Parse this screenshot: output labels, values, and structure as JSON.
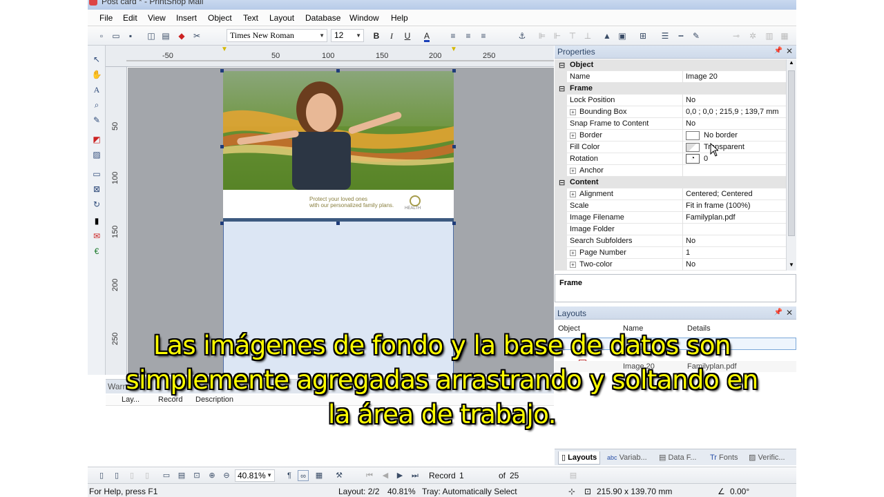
{
  "window": {
    "title": "Post card * - PrintShop Mail"
  },
  "menu": [
    "File",
    "Edit",
    "View",
    "Insert",
    "Object",
    "Text",
    "Layout",
    "Database",
    "Window",
    "Help"
  ],
  "toolbar": {
    "font": "Times New Roman",
    "size": "12",
    "bold": "B",
    "italic": "I",
    "underline": "U",
    "font_color": "A"
  },
  "ruler": {
    "top_labels": [
      "-50",
      "50",
      "100",
      "150",
      "200",
      "250"
    ],
    "left_labels": [
      "50",
      "100",
      "150",
      "200",
      "250"
    ]
  },
  "postcard": {
    "tagline_1": "Protect your loved ones",
    "tagline_2": "with our personalized family plans.",
    "logo_text": "HEALTH"
  },
  "warnings": {
    "title": "Warnin",
    "columns": [
      "Lay...",
      "Record",
      "Description"
    ]
  },
  "properties": {
    "title": "Properties",
    "rows": [
      {
        "type": "cat",
        "label": "Object"
      },
      {
        "type": "prop",
        "label": "Name",
        "value": "Image 20"
      },
      {
        "type": "cat",
        "label": "Frame"
      },
      {
        "type": "prop",
        "label": "Lock Position",
        "value": "No"
      },
      {
        "type": "expand",
        "label": "Bounding Box",
        "value": "0,0 ; 0,0 ; 215,9 ; 139,7 mm"
      },
      {
        "type": "prop",
        "label": "Snap Frame to Content",
        "value": "No"
      },
      {
        "type": "expand",
        "label": "Border",
        "value": "No border",
        "swatch": "border"
      },
      {
        "type": "prop",
        "label": "Fill Color",
        "value": "Transparent",
        "swatch": "fill"
      },
      {
        "type": "prop",
        "label": "Rotation",
        "value": "0",
        "swatch": "rotation"
      },
      {
        "type": "expand",
        "label": "Anchor",
        "value": ""
      },
      {
        "type": "cat",
        "label": "Content"
      },
      {
        "type": "expand",
        "label": "Alignment",
        "value": "Centered; Centered"
      },
      {
        "type": "prop",
        "label": "Scale",
        "value": "Fit in frame (100%)"
      },
      {
        "type": "prop",
        "label": "Image Filename",
        "value": "Familyplan.pdf"
      },
      {
        "type": "prop",
        "label": "Image Folder",
        "value": ""
      },
      {
        "type": "prop",
        "label": "Search Subfolders",
        "value": "No"
      },
      {
        "type": "expand",
        "label": "Page Number",
        "value": "1"
      },
      {
        "type": "expand",
        "label": "Two-color",
        "value": "No"
      }
    ],
    "description_title": "Frame"
  },
  "layouts": {
    "title": "Layouts",
    "columns": [
      "Object",
      "Name",
      "Details"
    ],
    "row_name": "Image 20",
    "row_details": "Familyplan.pdf",
    "tabs": [
      "Layouts",
      "Variab...",
      "Data F...",
      "Fonts",
      "Verific..."
    ]
  },
  "bottom": {
    "zoom": "40.81%",
    "record_label": "Record",
    "record_value": "1",
    "of_label": "of",
    "of_value": "25"
  },
  "status": {
    "help": "For Help, press F1",
    "layout": "Layout: 2/2",
    "zoom": "40.81%",
    "tray": "Tray: Automatically Select",
    "size": "215.90 x 139.70 mm",
    "angle": "0.00°"
  },
  "subtitle": [
    "Las imágenes de fondo y la base de datos son",
    "simplemente agregadas arrastrando y soltando en",
    "la área de trabajo."
  ]
}
